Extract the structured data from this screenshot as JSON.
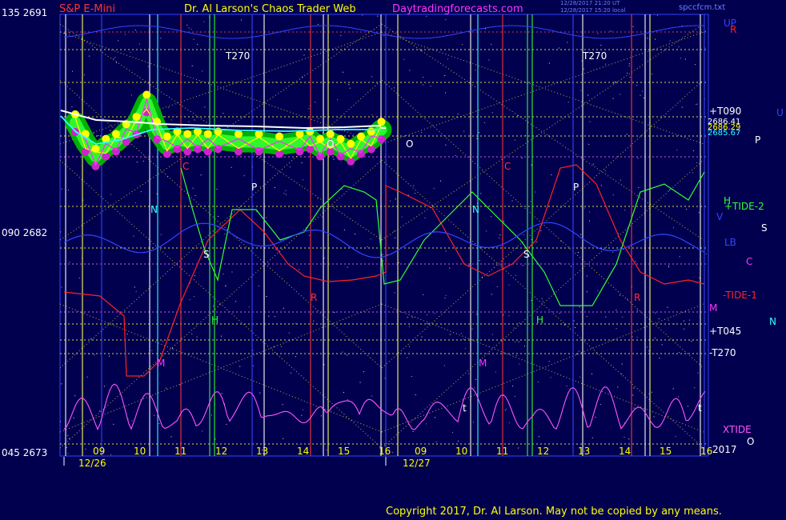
{
  "header": {
    "instrument": "S&P E-Mini",
    "title": "Dr. Al Larson's Chaos Trader Web",
    "site": "Daytradingforecasts.com",
    "timestamp_1": "12/28/2017 21:20 UT",
    "timestamp_2": "12/28/2017 15:20 local",
    "file": "spccfcm.txt"
  },
  "y_axis_labels": {
    "top": "135  2691",
    "middle": "090  2682",
    "bottom": "045  2673"
  },
  "right_labels": {
    "up": "UP",
    "r": "R",
    "u": "U",
    "t090": "+T090",
    "p1": "2686.41",
    "p2": "2686.29",
    "p3": "2685.67",
    "p": "P",
    "h": "H",
    "tide2": "+TIDE-2",
    "v": "V",
    "s": "S",
    "lb": "LB",
    "c": "C",
    "tide1": "-TIDE-1",
    "m": "M",
    "t045": "+T045",
    "n": "N",
    "t270": "-T270",
    "xtide": "XTIDE",
    "o": "O",
    "year": "2017"
  },
  "dates": {
    "day1": "12/26",
    "day2": "12/27"
  },
  "chart_labels": {
    "t270a": "T270",
    "t270b": "T270",
    "n1": "N",
    "n2": "N",
    "p1": "P",
    "p2": "P",
    "s1": "S",
    "s2": "S",
    "h1": "H",
    "h2": "H",
    "c1": "C",
    "c2": "C",
    "m1": "M",
    "m2": "M",
    "o1": "O",
    "o2": "O",
    "r1": "R",
    "r2": "R",
    "t1": "t",
    "t2": "t"
  },
  "footer": "Copyright 2017, Dr. Al Larson. May not be copied by any means.",
  "colors": {
    "background": "#00004f",
    "price": "#ffffff",
    "forecast_cyan": "#33ffff",
    "green_channel": "#00bb00",
    "magenta": "#ff33ff",
    "red_tide": "#ff2222",
    "green_tide": "#33ff33",
    "grid_yellow": "#ffff44",
    "xtide": "#ff55ff"
  },
  "chart_data": {
    "type": "line",
    "title": "S&P E-Mini",
    "ylim": [
      2673,
      2691
    ],
    "y_ticks": [
      2673,
      2682,
      2691
    ],
    "hour_labels": {
      "day1": [
        "09",
        "10",
        "11",
        "12",
        "13",
        "14",
        "15",
        "16"
      ],
      "day2": [
        "09",
        "10",
        "11",
        "12",
        "13",
        "14",
        "15",
        "16"
      ]
    },
    "price_day1": {
      "x": [
        8.5,
        8.75,
        9.0,
        9.25,
        9.5,
        9.75,
        10.0,
        10.25,
        10.5,
        10.75,
        11.0,
        11.25,
        11.5,
        11.75,
        12.0,
        12.5,
        13.0,
        13.5,
        14.0,
        14.25,
        14.5,
        14.75,
        15.0,
        15.25,
        15.5,
        15.75,
        16.0
      ],
      "y": [
        2686.6,
        2685.8,
        2685.2,
        2685.6,
        2685.8,
        2686.2,
        2686.5,
        2687.4,
        2686.3,
        2685.7,
        2685.9,
        2685.8,
        2685.9,
        2685.8,
        2685.9,
        2685.8,
        2685.8,
        2685.7,
        2685.8,
        2685.9,
        2685.6,
        2685.8,
        2685.6,
        2685.4,
        2685.7,
        2685.9,
        2686.3
      ]
    },
    "last_prices": [
      2686.41,
      2686.29,
      2685.67
    ]
  }
}
